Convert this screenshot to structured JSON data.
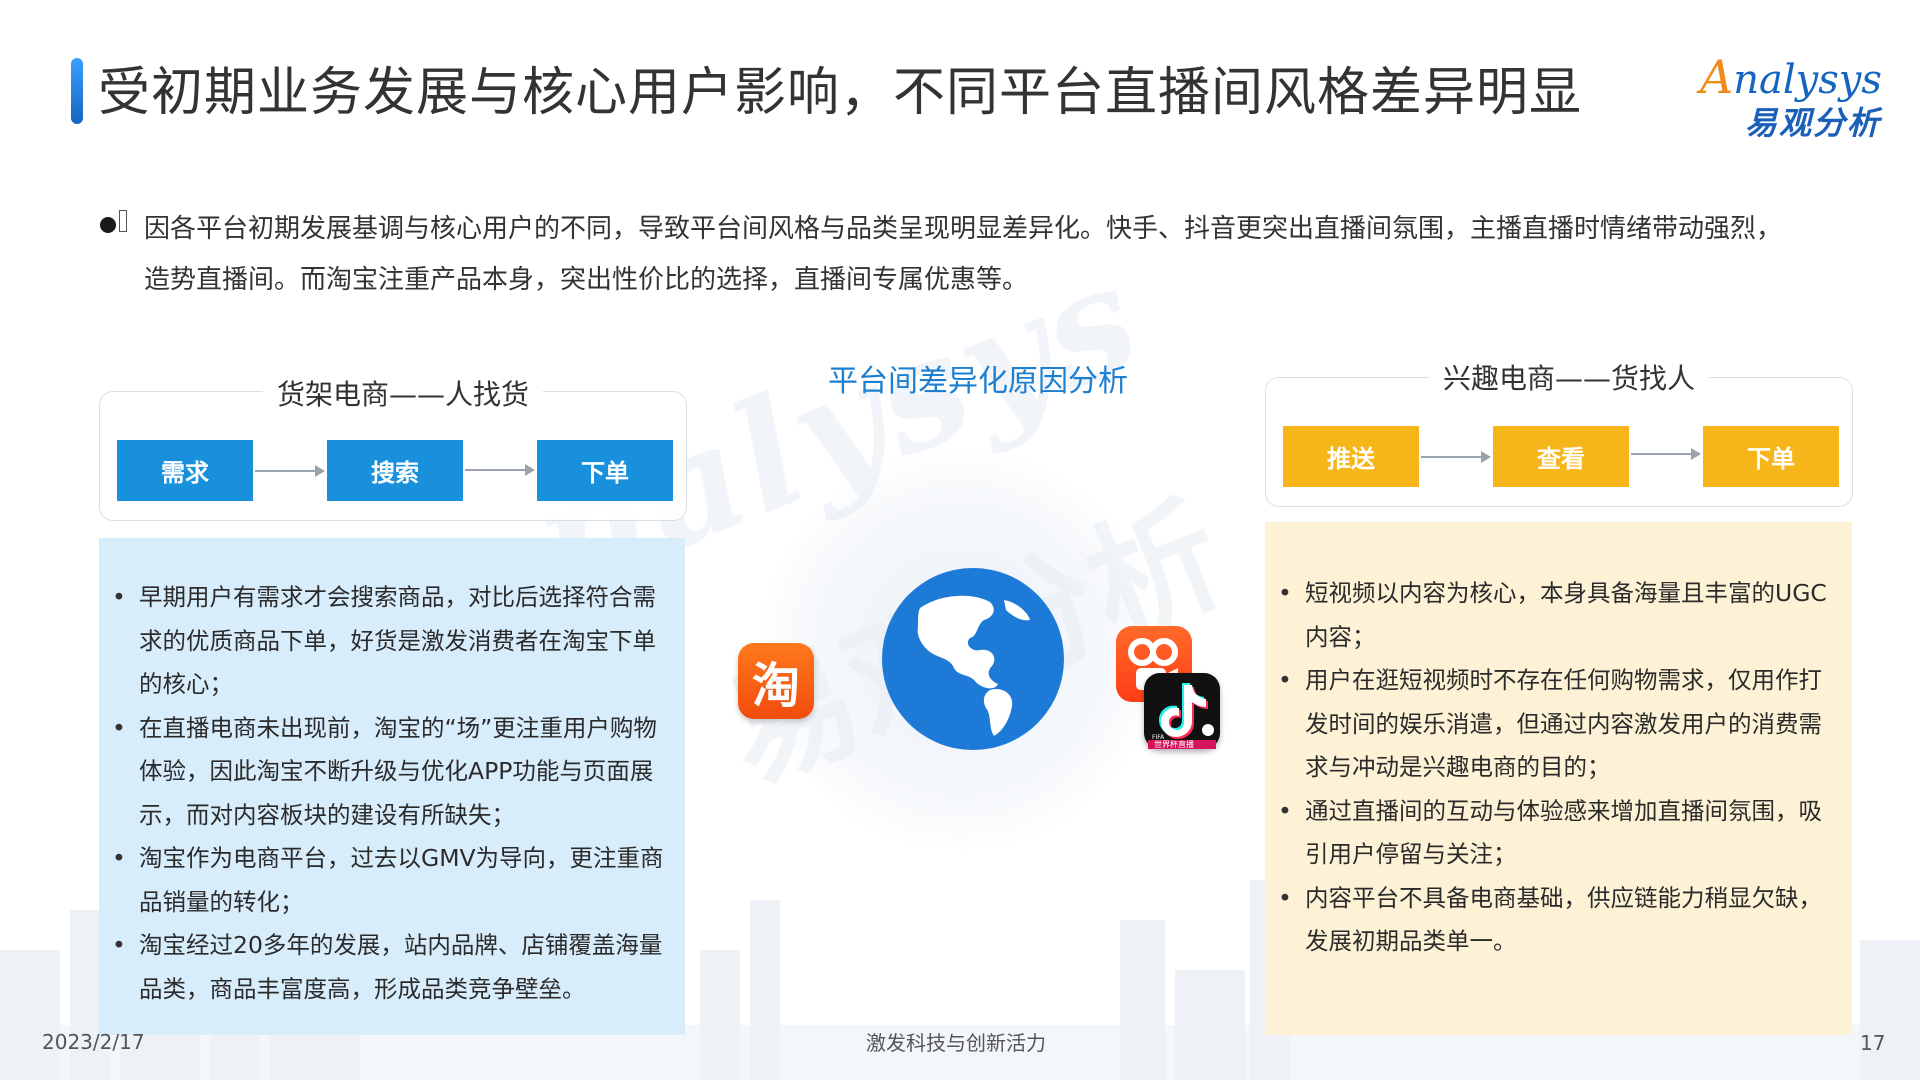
{
  "title": "受初期业务发展与核心用户影响，不同平台直播间风格差异明显",
  "logo": {
    "en": "nalysys",
    "en_initial": "A",
    "cn": "易观分析"
  },
  "intro": "因各平台初期发展基调与核心用户的不同，导致平台间风格与品类呈现明显差异化。快手、抖音更突出直播间氛围，主播直播时情绪带动强烈，造势直播间。而淘宝注重产品本身，突出性价比的选择，直播间专属优惠等。",
  "left_flow": {
    "title": "货架电商——人找货",
    "steps": [
      "需求",
      "搜索",
      "下单"
    ]
  },
  "right_flow": {
    "title": "兴趣电商——货找人",
    "steps": [
      "推送",
      "查看",
      "下单"
    ]
  },
  "center_title": "平台间差异化原因分析",
  "left_points": [
    "早期用户有需求才会搜索商品，对比后选择符合需求的优质商品下单，好货是激发消费者在淘宝下单的核心；",
    "在直播电商未出现前，淘宝的“场”更注重用户购物体验，因此淘宝不断升级与优化APP功能与页面展示，而对内容板块的建设有所缺失；",
    "淘宝作为电商平台，过去以GMV为导向，更注重商品销量的转化；",
    "淘宝经过20多年的发展，站内品牌、店铺覆盖海量品类，商品丰富度高，形成品类竞争壁垒。"
  ],
  "right_points": [
    "短视频以内容为核心，本身具备海量且丰富的UGC内容；",
    "用户在逛短视频时不存在任何购物需求，仅用作打发时间的娱乐消遣，但通过内容激发用户的消费需求与冲动是兴趣电商的目的；",
    "通过直播间的互动与体验感来增加直播间氛围，吸引用户停留与关注；",
    "内容平台不具备电商基础，供应链能力稍显欠缺，发展初期品类单一。"
  ],
  "icons": {
    "taobao_glyph": "淘",
    "douyin_badge": "世界杯直播",
    "douyin_fifa": "FIFA"
  },
  "footer": {
    "date": "2023/2/17",
    "slogan": "激发科技与创新活力",
    "page": "17"
  },
  "colors": {
    "accent_blue": "#1890dc",
    "accent_yellow": "#f6b61a",
    "title_blue": "#1d7fd0"
  }
}
